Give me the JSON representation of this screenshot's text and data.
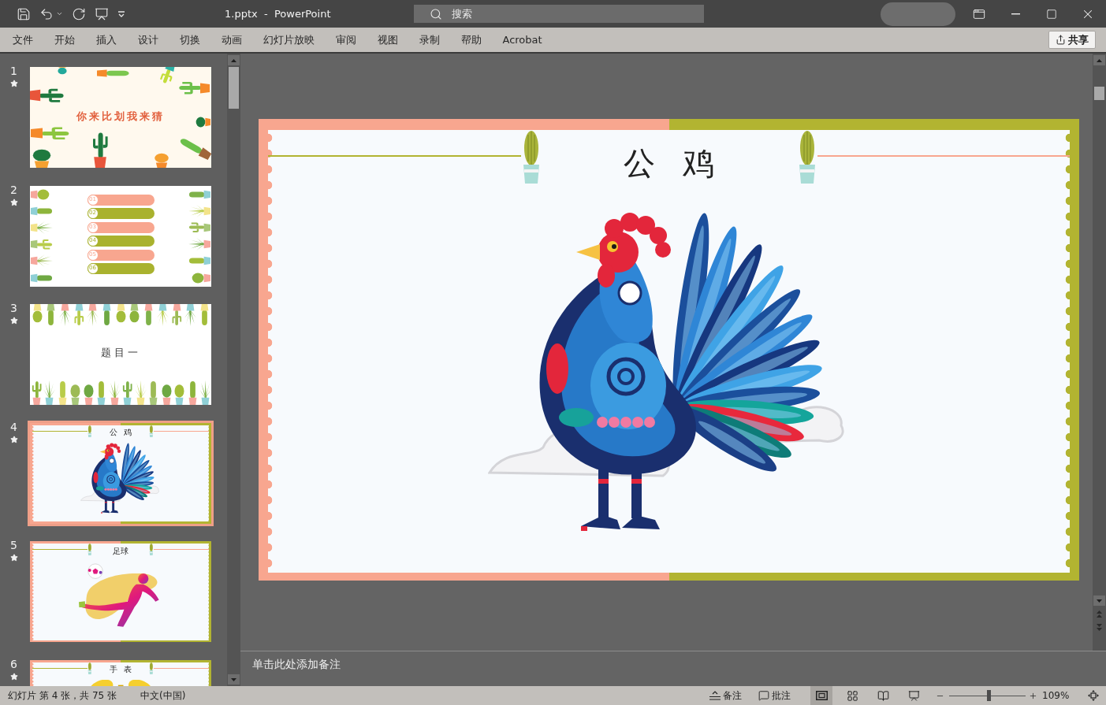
{
  "title_bar": {
    "title": "1.pptx  -  PowerPoint",
    "search": {
      "placeholder": "搜索"
    }
  },
  "ribbon_tabs": [
    {
      "label": "文件",
      "selected": false
    },
    {
      "label": "开始",
      "selected": false
    },
    {
      "label": "插入",
      "selected": false
    },
    {
      "label": "设计",
      "selected": false
    },
    {
      "label": "切换",
      "selected": false
    },
    {
      "label": "动画",
      "selected": false
    },
    {
      "label": "幻灯片放映",
      "selected": false
    },
    {
      "label": "审阅",
      "selected": false
    },
    {
      "label": "视图",
      "selected": false
    },
    {
      "label": "录制",
      "selected": false
    },
    {
      "label": "帮助",
      "selected": false
    },
    {
      "label": "Acrobat",
      "selected": false
    }
  ],
  "share_button": {
    "label": "共享"
  },
  "slides": [
    {
      "number": "1",
      "animated": true,
      "selected": false,
      "kind": "cactus_title",
      "title": "你来比划我来猜"
    },
    {
      "number": "2",
      "animated": true,
      "selected": false,
      "kind": "agenda",
      "items": [
        {
          "number": "01",
          "color": "#f8a68f"
        },
        {
          "number": "02",
          "color": "#a9b22e"
        },
        {
          "number": "03",
          "color": "#f8a68f"
        },
        {
          "number": "04",
          "color": "#a9b22e"
        },
        {
          "number": "05",
          "color": "#f8a68f"
        },
        {
          "number": "06",
          "color": "#a9b22e"
        }
      ]
    },
    {
      "number": "3",
      "animated": true,
      "selected": false,
      "kind": "cactus_rows",
      "title": "题目一"
    },
    {
      "number": "4",
      "animated": true,
      "selected": true,
      "kind": "framed_picture",
      "title": "公 鸡",
      "picture": {
        "kind": "rooster"
      }
    },
    {
      "number": "5",
      "animated": true,
      "selected": false,
      "kind": "framed_picture",
      "title": "足球",
      "picture": {
        "kind": "soccer"
      }
    },
    {
      "number": "6",
      "animated": true,
      "selected": false,
      "kind": "framed_picture",
      "title": "手 表",
      "picture": {
        "kind": "clock"
      }
    }
  ],
  "editor": {
    "slide": {
      "title": "公 鸡",
      "picture": {
        "kind": "rooster"
      }
    },
    "notes": {
      "placeholder": "单击此处添加备注"
    }
  },
  "status_bar": {
    "slide_position": "幻灯片 第 4 张，共 75 张",
    "language": "中文(中国)",
    "notes_button": "备注",
    "comments_button": "批注",
    "views": [
      {
        "kind": "normal",
        "selected": true
      },
      {
        "kind": "sorter",
        "selected": false
      },
      {
        "kind": "reading",
        "selected": false
      },
      {
        "kind": "slideshow",
        "selected": false
      }
    ],
    "zoom": {
      "level": 0.52,
      "reading": "109%"
    }
  }
}
